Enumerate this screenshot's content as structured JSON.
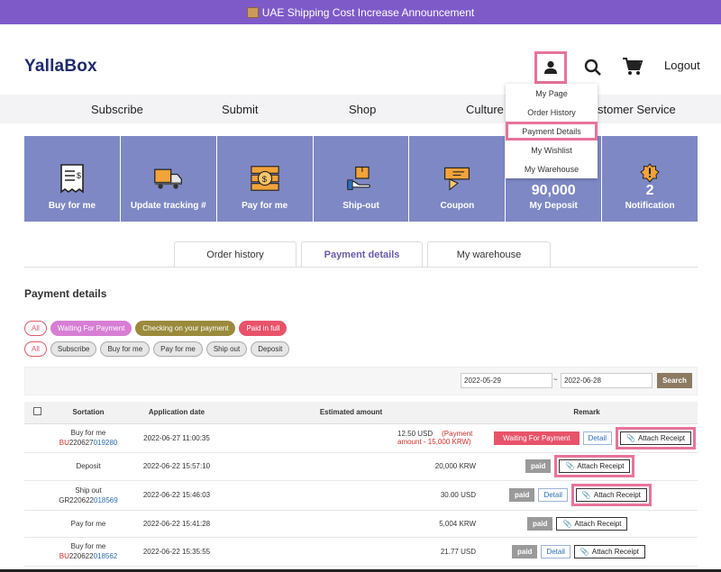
{
  "announcement": {
    "text": "UAE Shipping Cost Increase Announcement",
    "icon": "box-icon"
  },
  "header": {
    "logo": "YallaBox",
    "logout": "Logout"
  },
  "user_menu": {
    "items": [
      {
        "label": "My Page",
        "highlighted": false
      },
      {
        "label": "Order History",
        "highlighted": false
      },
      {
        "label": "Payment Details",
        "highlighted": true
      },
      {
        "label": "My Wishlist",
        "highlighted": false
      },
      {
        "label": "My Warehouse",
        "highlighted": false
      }
    ]
  },
  "nav": {
    "items": [
      "Subscribe",
      "Submit",
      "Shop",
      "Culture",
      "Customer Service"
    ],
    "customer_service_visible": "stomer Service"
  },
  "tiles": [
    {
      "label": "Buy for me",
      "icon": "receipt-icon"
    },
    {
      "label": "Update tracking #",
      "icon": "truck-icon"
    },
    {
      "label": "Pay for me",
      "icon": "money-icon"
    },
    {
      "label": "Ship-out",
      "icon": "hand-box-icon"
    },
    {
      "label": "Coupon",
      "icon": "coupon-icon"
    },
    {
      "label": "My Deposit",
      "value": "90,000"
    },
    {
      "label": "Notification",
      "value": "2",
      "icon": "alert-icon"
    }
  ],
  "tabs": [
    {
      "label": "Order history",
      "active": false
    },
    {
      "label": "Payment details",
      "active": true
    },
    {
      "label": "My warehouse",
      "active": false
    }
  ],
  "section_title": "Payment details",
  "status_filters": [
    "All",
    "Waiting For Payment",
    "Checking on your payment",
    "Paid in full"
  ],
  "type_filters": [
    "All",
    "Subscribe",
    "Buy for me",
    "Pay for me",
    "Ship out",
    "Deposit"
  ],
  "date_range": {
    "from": "2022-05-29",
    "separator": "~",
    "to": "2022-06-28",
    "search_label": "Search"
  },
  "table": {
    "headers": [
      "Sortation",
      "Application date",
      "Estimated amount",
      "Remark"
    ],
    "rows": [
      {
        "type": "Buy for me",
        "code_prefix": "BU",
        "code_mid": "220627",
        "code_suffix": "019280",
        "date": "2022-06-27 11:00:35",
        "amount": "12.50 USD",
        "note": "(Payment amount - 15,000 KRW)",
        "status": "Waiting For Payment",
        "detail": "Detail",
        "attach": "Attach Receipt",
        "highlight": true
      },
      {
        "type": "Deposit",
        "code_prefix": "",
        "code_mid": "",
        "code_suffix": "",
        "date": "2022-06-22 15:57:10",
        "amount": "20,000 KRW",
        "note": "",
        "status": "paid",
        "detail": "",
        "attach": "Attach Receipt",
        "highlight": true
      },
      {
        "type": "Ship out",
        "code_prefix": "GR",
        "code_mid": "220622",
        "code_suffix": "018569",
        "date": "2022-06-22 15:46:03",
        "amount": "30.00 USD",
        "note": "",
        "status": "paid",
        "detail": "Detail",
        "attach": "Attach Receipt",
        "highlight": true
      },
      {
        "type": "Pay for me",
        "code_prefix": "",
        "code_mid": "",
        "code_suffix": "",
        "date": "2022-06-22 15:41:28",
        "amount": "5,004 KRW",
        "note": "",
        "status": "paid",
        "detail": "",
        "attach": "Attach Receipt",
        "highlight": false
      },
      {
        "type": "Buy for me",
        "code_prefix": "BU",
        "code_mid": "220622",
        "code_suffix": "018562",
        "date": "2022-06-22 15:35:55",
        "amount": "21.77 USD",
        "note": "",
        "status": "paid",
        "detail": "Detail",
        "attach": "Attach Receipt",
        "highlight": false
      }
    ]
  },
  "colors": {
    "announce": "#7e5ac9",
    "tile": "#7e88c4",
    "highlight": "#e8749a",
    "waiting": "#e8536a",
    "logo": "#1f2a6d"
  }
}
